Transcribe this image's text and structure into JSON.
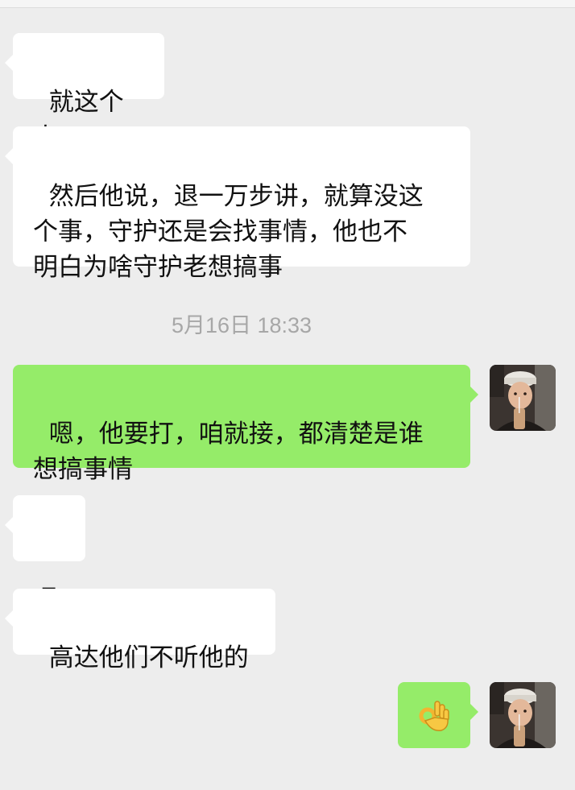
{
  "messages": [
    {
      "side": "left",
      "text": "就这个人"
    },
    {
      "side": "left",
      "text": "然后他说，退一万步讲，就算没这\n个事，守护还是会找事情，他也不\n明白为啥守护老想搞事"
    },
    {
      "side": "right",
      "text": "嗯，他要打，咱就接，都清楚是谁\n想搞事情"
    },
    {
      "side": "left",
      "text": "嗯"
    },
    {
      "side": "left",
      "text": "高达他们不听他的"
    },
    {
      "side": "right",
      "emoji": "ok-hand-icon"
    }
  ],
  "timestamp": "5月16日 18:33",
  "colors": {
    "background": "#ededed",
    "incoming_bubble": "#ffffff",
    "outgoing_bubble": "#95ec69",
    "timestamp_text": "#a7a7a7"
  }
}
